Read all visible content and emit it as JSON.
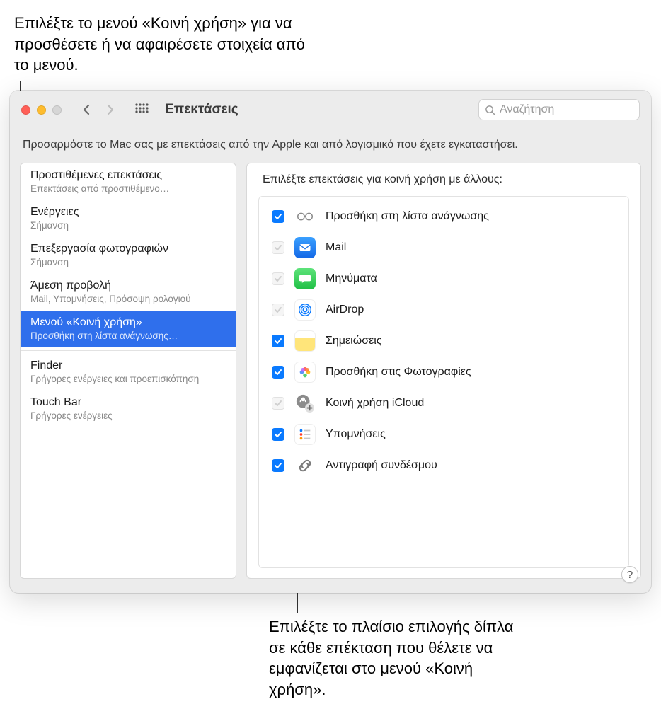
{
  "callouts": {
    "top": "Επιλέξτε το μενού «Κοινή χρήση» για να προσθέσετε ή να αφαιρέσετε στοιχεία από το μενού.",
    "bottom": "Επιλέξτε το πλαίσιο επιλογής δίπλα σε κάθε επέκταση που θέλετε να εμφανίζεται στο μενού «Κοινή χρήση»."
  },
  "window": {
    "title": "Επεκτάσεις",
    "search_placeholder": "Αναζήτηση",
    "subtitle": "Προσαρμόστε το Mac σας με επεκτάσεις από την Apple και από λογισμικό που έχετε εγκαταστήσει.",
    "help_label": "?"
  },
  "sidebar": {
    "items": [
      {
        "title": "Προστιθέμενες επεκτάσεις",
        "sub": "Επεκτάσεις από προστιθέμενο…"
      },
      {
        "title": "Ενέργειες",
        "sub": "Σήμανση"
      },
      {
        "title": "Επεξεργασία φωτογραφιών",
        "sub": "Σήμανση"
      },
      {
        "title": "Άμεση προβολή",
        "sub": "Mail, Υπομνήσεις, Πρόσοψη ρολογιού"
      },
      {
        "title": "Μενού «Κοινή χρήση»",
        "sub": "Προσθήκη στη λίστα ανάγνωσης…"
      },
      {
        "title": "Finder",
        "sub": "Γρήγορες ενέργειες και προεπισκόπηση"
      },
      {
        "title": "Touch Bar",
        "sub": "Γρήγορες ενέργειες"
      }
    ],
    "selected_index": 4
  },
  "panel": {
    "title": "Επιλέξτε επεκτάσεις για κοινή χρήση με άλλους:",
    "items": [
      {
        "label": "Προσθήκη στη λίστα ανάγνωσης",
        "checked": true,
        "locked": false,
        "icon": "glasses",
        "icon_bg": "#ffffff"
      },
      {
        "label": "Mail",
        "checked": false,
        "locked": true,
        "icon": "mail",
        "icon_bg": "#1f8bff"
      },
      {
        "label": "Μηνύματα",
        "checked": false,
        "locked": true,
        "icon": "msg",
        "icon_bg": "#34c759"
      },
      {
        "label": "AirDrop",
        "checked": false,
        "locked": true,
        "icon": "airdrop",
        "icon_bg": "#ffffff"
      },
      {
        "label": "Σημειώσεις",
        "checked": true,
        "locked": false,
        "icon": "notes",
        "icon_bg": "#ffffff"
      },
      {
        "label": "Προσθήκη στις Φωτογραφίες",
        "checked": true,
        "locked": false,
        "icon": "photos",
        "icon_bg": "#ffffff"
      },
      {
        "label": "Κοινή χρήση iCloud",
        "checked": false,
        "locked": true,
        "icon": "icloud",
        "icon_bg": "#ffffff"
      },
      {
        "label": "Υπομνήσεις",
        "checked": true,
        "locked": false,
        "icon": "remind",
        "icon_bg": "#ffffff"
      },
      {
        "label": "Αντιγραφή συνδέσμου",
        "checked": true,
        "locked": false,
        "icon": "link",
        "icon_bg": "#ffffff"
      }
    ]
  }
}
